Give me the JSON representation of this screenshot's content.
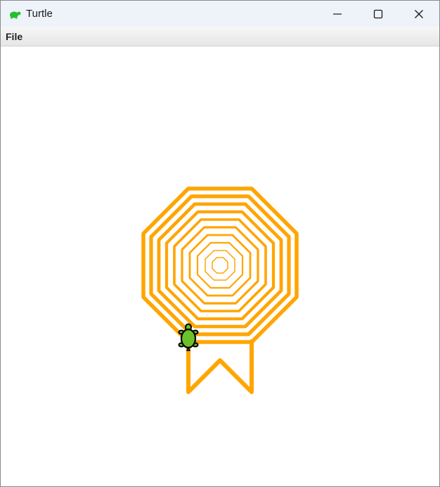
{
  "window": {
    "title": "Turtle",
    "app_icon": "turtle-icon",
    "controls": [
      "minimize-icon",
      "maximize-icon",
      "close-icon"
    ]
  },
  "menubar": {
    "items": [
      {
        "label": "File"
      }
    ]
  },
  "canvas": {
    "background": "#ffffff",
    "pen_color": "#ffa500",
    "turtle_color": "#6cc02a",
    "turtle_outline": "#000000"
  }
}
